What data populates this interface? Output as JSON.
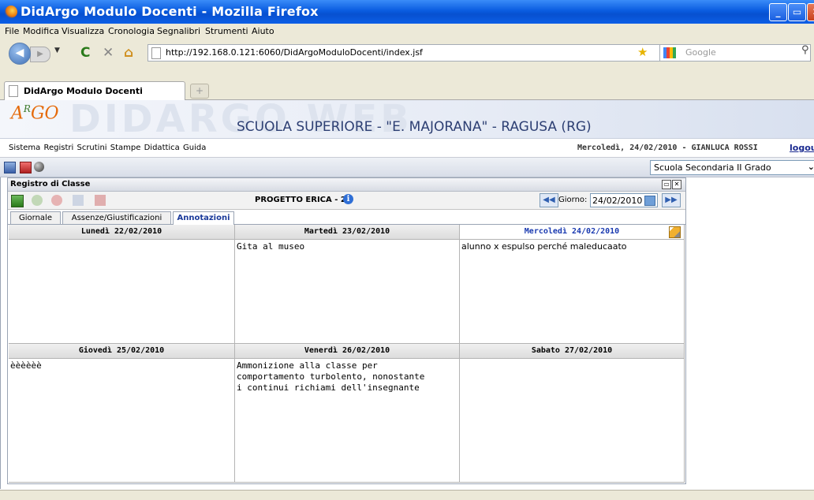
{
  "window": {
    "title": "DidArgo Modulo Docenti - Mozilla Firefox",
    "buttons": {
      "minimize": "_",
      "maximize": "▭",
      "close": "✕"
    }
  },
  "menubar": [
    "File",
    "Modifica",
    "Visualizza",
    "Cronologia",
    "Segnalibri",
    "Strumenti",
    "Aiuto"
  ],
  "nav": {
    "url": "http://192.168.0.121:6060/DidArgoModuloDocenti/index.jsf",
    "search_placeholder": "Google"
  },
  "tab": {
    "label": "DidArgo Modulo Docenti",
    "new_tab": "+"
  },
  "header": {
    "logo_small": "ARGO",
    "logo_big": "DIDARGO WEB",
    "school": "SCUOLA SUPERIORE - \"E. MAJORANA\" - RAGUSA (RG)"
  },
  "appbar": {
    "menu": [
      "Sistema",
      "Registri",
      "Scrutini",
      "Stampe",
      "Didattica",
      "Guida"
    ],
    "date_user": "Mercoledì, 24/02/2010 - GIANLUCA ROSSI",
    "logout": "logout"
  },
  "school_select": {
    "value": "Scuola Secondaria II Grado"
  },
  "panel": {
    "title": "Registro di Classe",
    "class_label": "PROGETTO ERICA - 2A",
    "giorno_label": "Giorno:",
    "giorno_value": "24/02/2010",
    "tabs": [
      "Giornale",
      "Assenze/Giustificazioni",
      "Annotazioni"
    ],
    "active_tab": "Annotazioni"
  },
  "days": [
    {
      "header": "Lunedì 22/02/2010",
      "note": ""
    },
    {
      "header": "Martedì 23/02/2010",
      "note": "Gita al museo"
    },
    {
      "header": "Mercoledì 24/02/2010",
      "note": "alunno x espulso perché maleducaato",
      "today": true
    },
    {
      "header": "Giovedì 25/02/2010",
      "note": "èèèèèè"
    },
    {
      "header": "Venerdì 26/02/2010",
      "note": "Ammonizione alla classe per\ncomportamento turbolento, nonostante\ni continui richiami dell'insegnante"
    },
    {
      "header": "Sabato 27/02/2010",
      "note": ""
    }
  ],
  "colors": {
    "titlebar": "#0a5ce0",
    "accent": "#1a3ab0",
    "header_text": "#2d3f73"
  }
}
